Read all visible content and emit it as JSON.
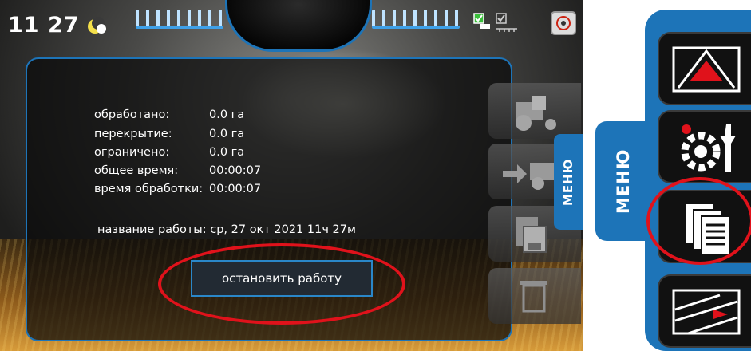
{
  "status_bar": {
    "time": "11 27"
  },
  "stats": [
    {
      "label": "обработано:",
      "value": "0.0 га"
    },
    {
      "label": "перекрытие:",
      "value": "0.0 га"
    },
    {
      "label": "ограничено:",
      "value": "0.0 га"
    },
    {
      "label": "общее время:",
      "value": "00:00:07"
    },
    {
      "label": "время обработки:",
      "value": "00:00:07"
    }
  ],
  "job": {
    "name_line": "название работы: ср, 27 окт 2021 11ч 27м"
  },
  "actions": {
    "stop_label": "остановить работу"
  },
  "menu": {
    "tab_label": "МЕНЮ",
    "panel_label": "МЕНЮ"
  },
  "colors": {
    "accent": "#1d74b8",
    "highlight": "#e0121b"
  }
}
